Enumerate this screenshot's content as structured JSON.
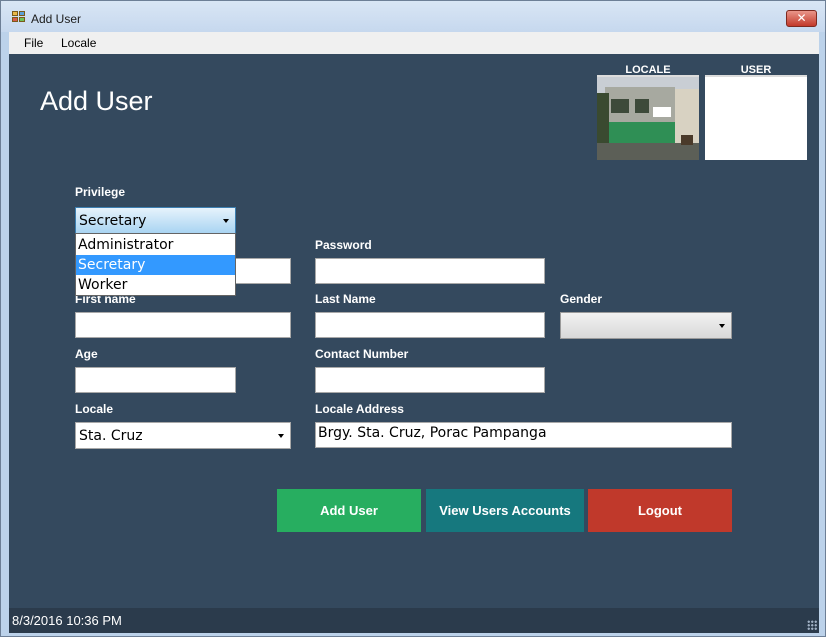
{
  "window": {
    "title": "Add User",
    "close_glyph": "✕"
  },
  "menu": [
    {
      "label": "File"
    },
    {
      "label": "Locale"
    }
  ],
  "page_title": "Add User",
  "images": {
    "locale_label": "LOCALE",
    "user_label": "USER"
  },
  "form": {
    "privilege": {
      "label": "Privilege",
      "value": "Secretary",
      "options": [
        "Administrator",
        "Secretary",
        "Worker"
      ],
      "highlighted": "Secretary"
    },
    "username": {
      "value": ""
    },
    "password": {
      "label": "Password",
      "value": ""
    },
    "first_name": {
      "label": "First name",
      "value": ""
    },
    "last_name": {
      "label": "Last Name",
      "value": ""
    },
    "gender": {
      "label": "Gender",
      "value": ""
    },
    "age": {
      "label": "Age",
      "value": ""
    },
    "contact_number": {
      "label": "Contact Number",
      "value": ""
    },
    "locale": {
      "label": "Locale",
      "value": "Sta. Cruz"
    },
    "locale_address": {
      "label": "Locale Address",
      "value": "Brgy. Sta. Cruz, Porac Pampanga"
    }
  },
  "buttons": {
    "add_user": {
      "label": "Add User",
      "color": "#27ae60"
    },
    "view_users": {
      "label": "View Users Accounts",
      "color": "#16787e"
    },
    "logout": {
      "label": "Logout",
      "color": "#c0392b"
    }
  },
  "status": {
    "text": "8/3/2016   10:36 PM"
  },
  "colors": {
    "background": "#34495e",
    "selection": "#3399ff"
  }
}
